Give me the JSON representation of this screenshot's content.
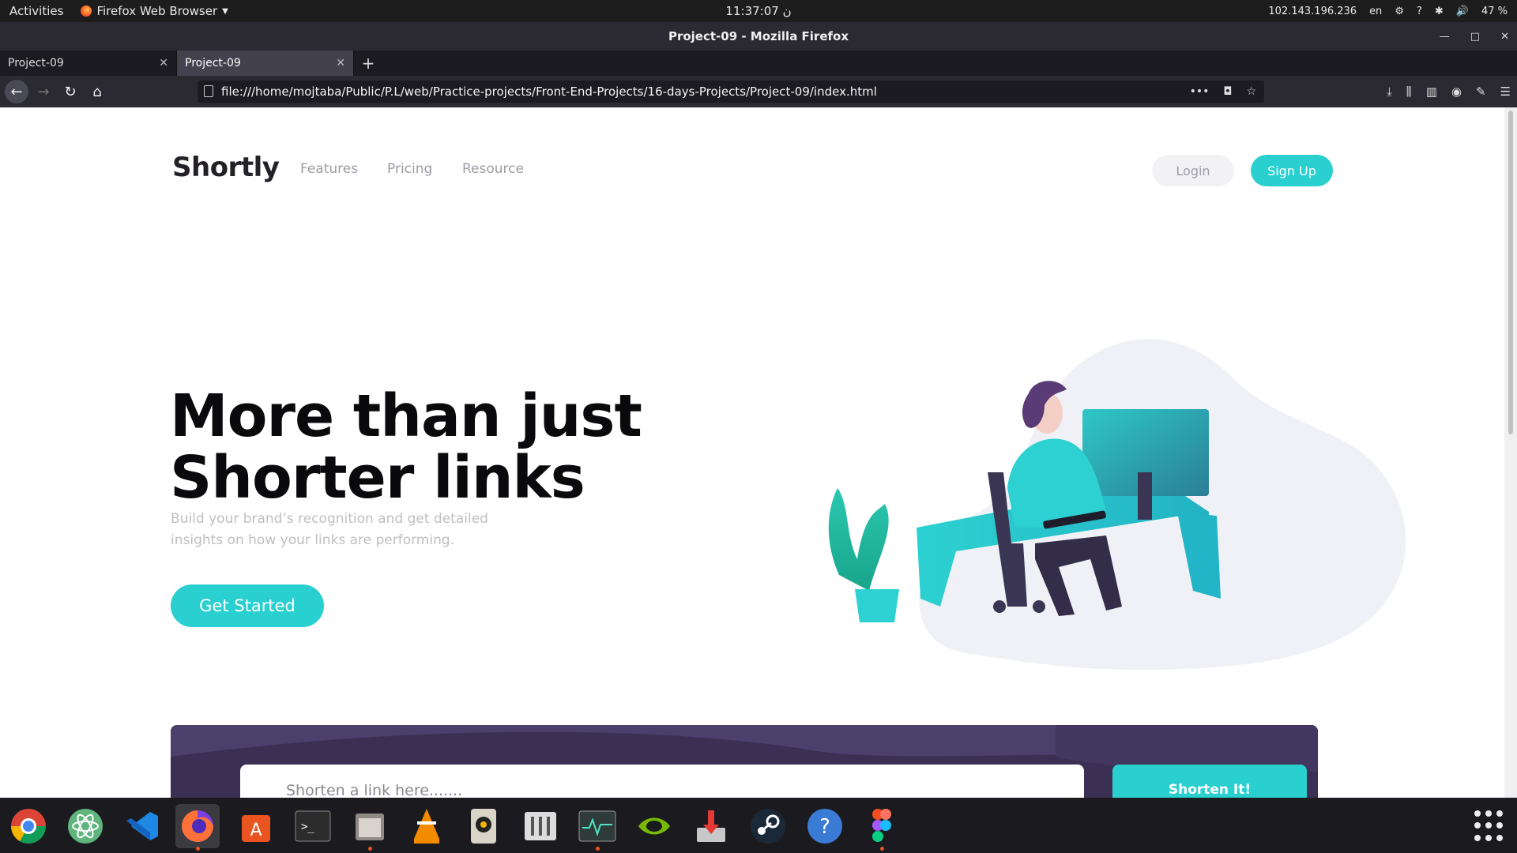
{
  "system_bar": {
    "activities": "Activities",
    "app_menu": "Firefox Web Browser",
    "clock": "11:37:07 ن",
    "ip": "102.143.196.236",
    "lang": "en",
    "battery": "47 %"
  },
  "window": {
    "title": "Project-09 - Mozilla Firefox"
  },
  "tabs": [
    {
      "label": "Project-09",
      "active": false
    },
    {
      "label": "Project-09",
      "active": true
    }
  ],
  "address_bar": {
    "url": "file:///home/mojtaba/Public/P.L/web/Practice-projects/Front-End-Projects/16-days-Projects/Project-09/index.html"
  },
  "page": {
    "logo": "Shortly",
    "nav": [
      "Features",
      "Pricing",
      "Resource"
    ],
    "login_label": "Login",
    "signup_label": "Sign Up",
    "hero_title_line1": "More than just",
    "hero_title_line2": "Shorter links",
    "hero_sub_line1": "Build your brand’s recognition and get detailed",
    "hero_sub_line2": "insights on how your links are performing.",
    "cta_label": "Get Started",
    "shorten_placeholder": "Shorten a link here.......",
    "shorten_button": "Shorten It!"
  },
  "colors": {
    "accent": "#2acfcf",
    "dark_violet": "#3b3054",
    "title": "#232127",
    "muted": "#9e9aa7"
  },
  "dock": [
    "chrome-icon",
    "atom-icon",
    "vscode-icon",
    "firefox-icon",
    "software-center-icon",
    "terminal-icon",
    "files-icon",
    "vlc-icon",
    "rhythmbox-icon",
    "mixer-icon",
    "system-monitor-icon",
    "nvidia-icon",
    "installer-icon",
    "steam-icon",
    "help-icon",
    "figma-icon"
  ]
}
